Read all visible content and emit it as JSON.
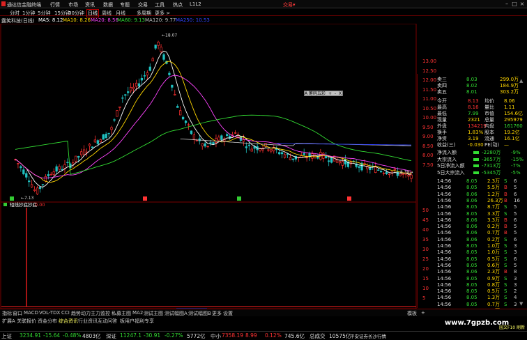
{
  "app": {
    "title": "通达信金融终端",
    "menu": [
      "行情",
      "市场",
      "资讯",
      "数据",
      "专题",
      "交易",
      "工具",
      "热点",
      "L1L2"
    ],
    "trade_label": "交易▾"
  },
  "periods": [
    {
      "label": "分时",
      "active": false
    },
    {
      "label": "1分钟",
      "active": false
    },
    {
      "label": "5分钟",
      "active": false
    },
    {
      "label": "15分钟",
      "active": false
    },
    {
      "label": "30分钟",
      "active": false
    },
    {
      "label": "日线",
      "active": true
    },
    {
      "label": "周线",
      "active": false
    },
    {
      "label": "月线",
      "active": false
    },
    {
      "label": "多周期",
      "active": false
    },
    {
      "label": "更多 >",
      "active": false
    }
  ],
  "ma": {
    "stock": "露笑科技(日线)",
    "items": [
      {
        "label": "MA5: 8.12",
        "color": "#ffffff"
      },
      {
        "label": "MA10: 8.26",
        "color": "#ffd700"
      },
      {
        "label": "MA20: 8.56",
        "color": "#ff44ff"
      },
      {
        "label": "MA60: 9.13",
        "color": "#33dd33"
      },
      {
        "label": "MA120: 9.77",
        "color": "#bbbbbb"
      },
      {
        "label": "MA250: 10.53",
        "color": "#3344ff"
      }
    ]
  },
  "price_axis": [
    "13.00",
    "12.50",
    "12.00",
    "11.50",
    "11.00",
    "10.50",
    "10.00",
    "9.50",
    "9.00",
    "8.50",
    "8.00",
    "7.50"
  ],
  "annotations": {
    "high": "18.07",
    "low": "7.13",
    "last": "8.30"
  },
  "indicator": {
    "name": "短线抄底抄底",
    "value": "0.00"
  },
  "indicator_axis": [
    "50",
    "45",
    "40",
    "35",
    "30",
    "25",
    "20",
    "15",
    "10",
    "5"
  ],
  "event_marks": [
    {
      "label": "B",
      "color": "#33cc33"
    },
    {
      "label": "S",
      "color": "#ff3333"
    },
    {
      "label": "B",
      "color": "#33cc33"
    },
    {
      "label": "S",
      "color": "#ff3333"
    }
  ],
  "date_axis": {
    "labels": [
      "2022年",
      "5",
      "6",
      "7",
      "8",
      "9",
      "10",
      "11",
      "12",
      "2",
      "3"
    ],
    "cursor": "2022/08/31/三"
  },
  "floatbox": {
    "label": "A 筹码五彩",
    "btns": [
      "+",
      "-",
      "X"
    ]
  },
  "quote": {
    "asks": [
      {
        "name": "卖三",
        "price": "8.03",
        "vol": "299.0万"
      },
      {
        "name": "卖四",
        "price": "8.02",
        "vol": "184.9万"
      },
      {
        "name": "卖五",
        "price": "8.01",
        "vol": "303.2万"
      }
    ],
    "stats": [
      {
        "l1": "今开",
        "v1": "8.13",
        "l2": "均价",
        "v2": "8.06"
      },
      {
        "l1": "最高",
        "v1": "8.16",
        "l2": "量比",
        "v2": "1.11"
      },
      {
        "l1": "最低",
        "v1": "7.99",
        "l2": "市值",
        "v2": "154.6亿"
      },
      {
        "l1": "现量",
        "v1": "2321",
        "l2": "总量",
        "v2": "295979"
      },
      {
        "l1": "外盘",
        "v1": "134219",
        "l2": "内盘",
        "v2": "161760"
      },
      {
        "l1": "换手",
        "v1": "1.83%",
        "l2": "股本",
        "v2": "19.2亿"
      },
      {
        "l1": "净资",
        "v1": "3.19",
        "l2": "流通",
        "v2": "16.1亿"
      },
      {
        "l1": "收益(三)",
        "v1": "-0.030",
        "l2": "PE(动)",
        "v2": "—"
      }
    ],
    "flows": [
      {
        "label": "净流入额",
        "value": "-2280万",
        "pct": "-9%"
      },
      {
        "label": "大宗流入",
        "value": "-3657万",
        "pct": "-15%"
      },
      {
        "label": "5日净流入额",
        "value": "-7313万",
        "pct": "-7%"
      },
      {
        "label": "5日大宗流入",
        "value": "-5345万",
        "pct": "-5%"
      }
    ]
  },
  "ticks": [
    {
      "t": "14:56",
      "p": "8.05",
      "v": "2.3万",
      "d": "S",
      "n": "6"
    },
    {
      "t": "14:56",
      "p": "8.05",
      "v": "5.5万",
      "d": "B",
      "n": "5"
    },
    {
      "t": "14:56",
      "p": "8.06",
      "v": "1.2万",
      "d": "B",
      "n": "6"
    },
    {
      "t": "14:56",
      "p": "8.06",
      "v": "26.3万",
      "d": "B",
      "n": "16"
    },
    {
      "t": "14:56",
      "p": "8.05",
      "v": "8.7万",
      "d": "S",
      "n": "5"
    },
    {
      "t": "14:56",
      "p": "8.05",
      "v": "3.3万",
      "d": "S",
      "n": "5"
    },
    {
      "t": "14:56",
      "p": "8.06",
      "v": "3.3万",
      "d": "B",
      "n": "6"
    },
    {
      "t": "14:56",
      "p": "8.06",
      "v": "0.2万",
      "d": "B",
      "n": "5"
    },
    {
      "t": "14:56",
      "p": "8.06",
      "v": "0.7万",
      "d": "B",
      "n": "5"
    },
    {
      "t": "14:56",
      "p": "8.06",
      "v": "0.2万",
      "d": "S",
      "n": "6"
    },
    {
      "t": "14:56",
      "p": "8.05",
      "v": "1.0万",
      "d": "S",
      "n": "3"
    },
    {
      "t": "14:56",
      "p": "8.05",
      "v": "1.0万",
      "d": "S",
      "n": "3"
    },
    {
      "t": "14:56",
      "p": "8.05",
      "v": "0.5万",
      "d": "S",
      "n": "6"
    },
    {
      "t": "14:56",
      "p": "8.05",
      "v": "0.6万",
      "d": "S",
      "n": "5"
    },
    {
      "t": "14:56",
      "p": "8.06",
      "v": "2.3万",
      "d": "B",
      "n": "8"
    },
    {
      "t": "14:56",
      "p": "8.05",
      "v": "0.9万",
      "d": "S",
      "n": "3"
    },
    {
      "t": "14:56",
      "p": "8.05",
      "v": "0.8万",
      "d": "S",
      "n": "3"
    },
    {
      "t": "14:56",
      "p": "8.05",
      "v": "0.5万",
      "d": "S",
      "n": "2"
    },
    {
      "t": "14:56",
      "p": "8.05",
      "v": "1.3万",
      "d": "S",
      "n": "4"
    },
    {
      "t": "14:56",
      "p": "8.05",
      "v": "0.7万",
      "d": "S",
      "n": "3"
    },
    {
      "t": "15:00",
      "p": "8.05",
      "v": "4.6万",
      "d": "B",
      "n": "17"
    }
  ],
  "bottom_tabs": [
    "指标",
    "窗口",
    "MACD",
    "VOL-TDX",
    "CCI",
    "趋势动力",
    "主力监控",
    "私募主图",
    "MA2",
    "测试主图",
    "测试幅图A",
    "测试幅图B",
    "更多",
    "设置"
  ],
  "right_tabs": [
    "模板",
    "+"
  ],
  "ext_tabs": [
    "扩展A",
    "关联报价",
    "资金分布",
    "综合资讯",
    "行业资讯",
    "互动问答",
    "板用户福利专享"
  ],
  "index_bar": [
    {
      "name": "上证",
      "v": "3234.91",
      "c": "-15.64",
      "pct": "-0.48%",
      "amt": "4803亿"
    },
    {
      "name": "深证",
      "v": "11247.1",
      "c": "-30.91",
      "pct": "-0.27%",
      "amt": "5772亿"
    },
    {
      "name": "中小",
      "v": "7358.19",
      "c": "8.99",
      "pct": "0.12%",
      "amt": "745.6亿"
    }
  ],
  "status": {
    "left": "总成交",
    "amt": "10575亿",
    "text": "平安证券长沙行情"
  },
  "watermark": "www.7gpzb.com",
  "footer_small": "园文F10 刷新"
}
